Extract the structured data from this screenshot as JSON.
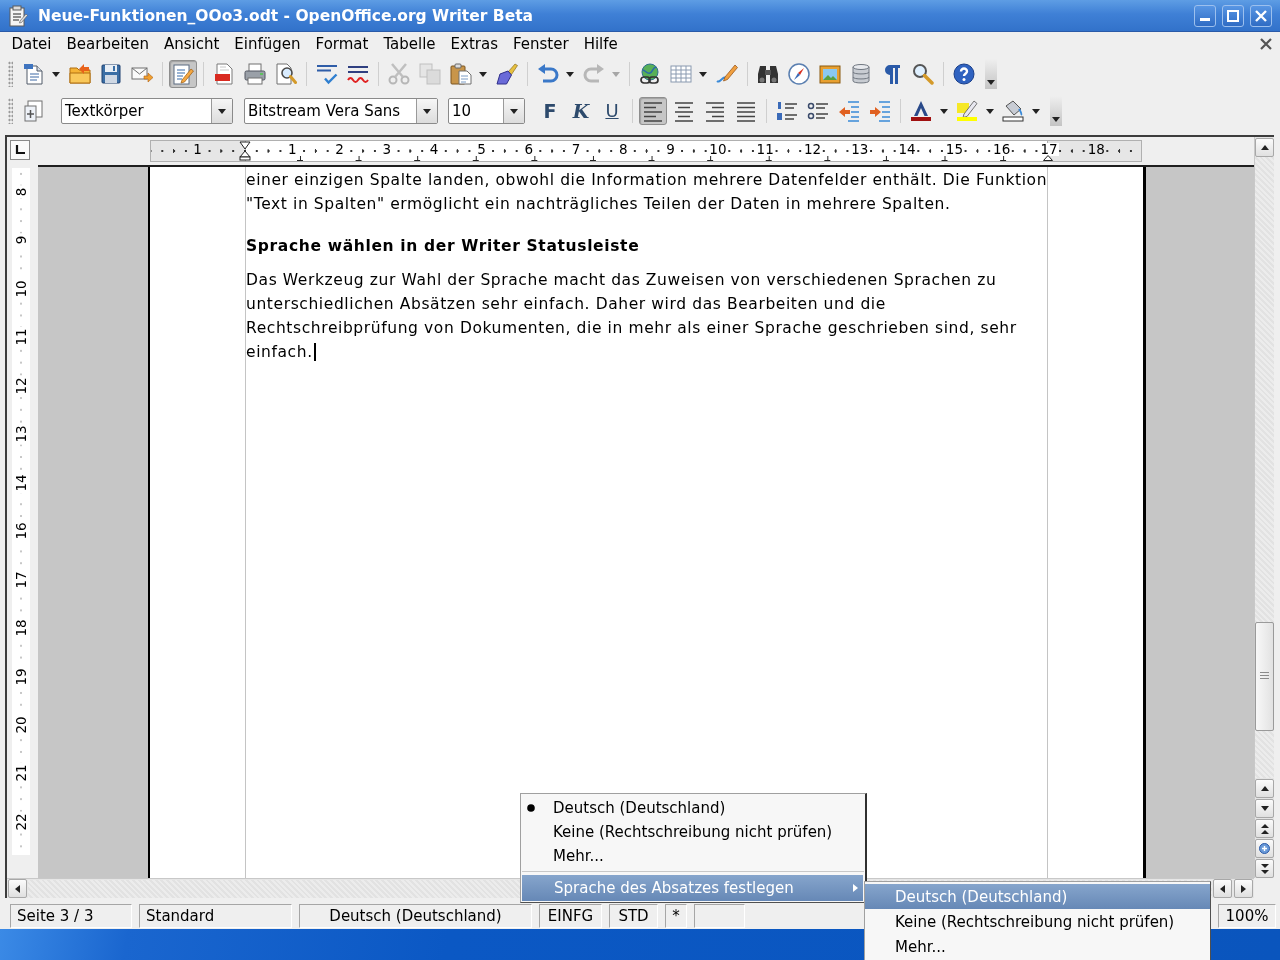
{
  "window": {
    "title": "Neue-Funktionen_OOo3.odt - OpenOffice.org Writer Beta"
  },
  "menu_bar": {
    "items": [
      "Datei",
      "Bearbeiten",
      "Ansicht",
      "Einfügen",
      "Format",
      "Tabelle",
      "Extras",
      "Fenster",
      "Hilfe"
    ]
  },
  "standard_toolbar": {
    "buttons": [
      {
        "on": false,
        "disabled": false
      },
      {
        "on": false,
        "disabled": false
      },
      {
        "on": false,
        "disabled": false
      },
      {
        "on": false,
        "disabled": false
      },
      {
        "on": true,
        "disabled": false
      },
      {
        "on": false,
        "disabled": false
      },
      {
        "on": false,
        "disabled": false
      },
      {
        "on": false,
        "disabled": false
      },
      {
        "on": false,
        "disabled": false
      },
      {
        "on": false,
        "disabled": false
      },
      {
        "on": false,
        "disabled": true
      },
      {
        "on": false,
        "disabled": true
      },
      {
        "on": false,
        "disabled": false
      },
      {
        "on": false,
        "disabled": false
      },
      {
        "on": false,
        "disabled": false
      },
      {
        "on": false,
        "disabled": true
      },
      {
        "on": false,
        "disabled": false
      },
      {
        "on": false,
        "disabled": false
      },
      {
        "on": false,
        "disabled": false
      },
      {
        "on": false,
        "disabled": false
      },
      {
        "on": false,
        "disabled": false
      },
      {
        "on": false,
        "disabled": false
      },
      {
        "on": false,
        "disabled": false
      },
      {
        "on": false,
        "disabled": false
      },
      {
        "on": false,
        "disabled": false
      },
      {
        "on": false,
        "disabled": false
      }
    ]
  },
  "formatting_toolbar": {
    "paragraph_style": {
      "value": "Textkörper"
    },
    "font_name": {
      "value": "Bitstream Vera Sans"
    },
    "font_size": {
      "value": "10"
    },
    "text_buttons": [
      {
        "kind": "bold",
        "label": "F",
        "on": false
      },
      {
        "kind": "italic",
        "label": "K",
        "on": false
      },
      {
        "kind": "underline",
        "label": "U",
        "on": false
      }
    ],
    "buttons": [
      {
        "on": true
      },
      {
        "on": false
      },
      {
        "on": false
      },
      {
        "on": false
      },
      {
        "on": false
      },
      {
        "on": false
      },
      {
        "on": false
      },
      {
        "on": false
      },
      {
        "on": false
      },
      {
        "on": false
      },
      {
        "on": false
      }
    ]
  },
  "horizontal_ruler": {
    "labels": [
      "1",
      "1",
      "2",
      "3",
      "4",
      "5",
      "6",
      "7",
      "8",
      "9",
      "10",
      "11",
      "12",
      "13",
      "14",
      "15",
      "16",
      "17",
      "18"
    ]
  },
  "vertical_ruler": {
    "labels": [
      "8",
      "9",
      "10",
      "11",
      "12",
      "13",
      "14",
      "16",
      "17",
      "18",
      "19",
      "20",
      "21",
      "22"
    ]
  },
  "document": {
    "paragraphs": [
      {
        "kind": "body",
        "cursor": false,
        "lines": [
          "einer einzigen Spalte landen, obwohl die Information mehrere Datenfelder enthält. Die Funktion",
          "\"Text in Spalten\" ermöglicht ein nachträgliches Teilen der Daten in mehrere Spalten."
        ]
      },
      {
        "kind": "heading",
        "cursor": false,
        "lines": [
          "Sprache wählen in der Writer Statusleiste"
        ]
      },
      {
        "kind": "body",
        "cursor": true,
        "lines": [
          "Das Werkzeug zur Wahl der Sprache macht das Zuweisen von verschiedenen Sprachen zu",
          "unterschiedlichen Absätzen sehr einfach. Daher wird das Bearbeiten und die",
          "Rechtschreibprüfung von Dokumenten, die in mehr als einer Sprache geschrieben sind, sehr",
          "einfach."
        ]
      }
    ]
  },
  "status_bar": {
    "fields": [
      "Seite 3 / 3",
      "Standard",
      "Deutsch (Deutschland)",
      "EINFG",
      "STD",
      "*"
    ],
    "zoom": "100%"
  },
  "context_menu": {
    "items": [
      {
        "label": "Deutsch (Deutschland)",
        "selected": true
      },
      {
        "label": "Keine (Rechtschreibung nicht prüfen)",
        "selected": false
      },
      {
        "label": "Mehr...",
        "selected": false
      }
    ],
    "submenu_item": {
      "label": "Sprache des Absatzes festlegen",
      "highlighted": true
    },
    "submenu": {
      "items": [
        {
          "label": "Deutsch (Deutschland)",
          "highlighted": true
        },
        {
          "label": "Keine (Rechtschreibung nicht prüfen)",
          "highlighted": false
        },
        {
          "label": "Mehr...",
          "highlighted": false
        }
      ]
    }
  }
}
